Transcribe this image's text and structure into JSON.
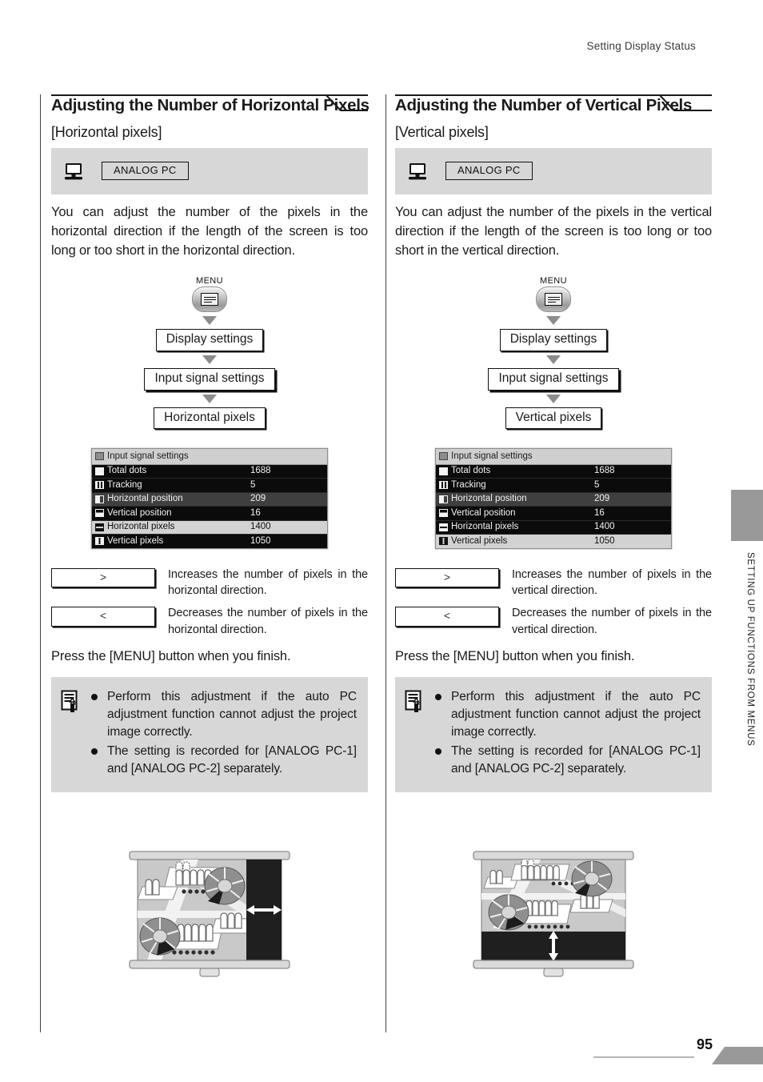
{
  "header": {
    "running_head": "Setting Display Status"
  },
  "footer": {
    "page_number": "95"
  },
  "side_tab": {
    "label": "SETTING UP FUNCTIONS FROM MENUS"
  },
  "columns": [
    {
      "title": "Adjusting the Number of Horizontal Pixels",
      "subtitle": "[Horizontal pixels]",
      "signal": {
        "icon": "analog-pc-monitor-icon",
        "chip": "ANALOG PC"
      },
      "description": "You can adjust the number of the pixels in the horizontal direction if the length of the screen is too long or too short in the horizontal direction.",
      "flow": {
        "menu_caption": "MENU",
        "steps": [
          "Display settings",
          "Input signal settings",
          "Horizontal pixels"
        ]
      },
      "osd": {
        "title": "Input signal settings",
        "rows": [
          {
            "icon": "fill-square-icon",
            "label": "Total dots",
            "value": "1688",
            "style": "dark"
          },
          {
            "icon": "bars-icon",
            "label": "Tracking",
            "value": "5",
            "style": "dark"
          },
          {
            "icon": "half-square-icon",
            "label": "Horizontal position",
            "value": "209",
            "style": "mid"
          },
          {
            "icon": "monitor-small-icon",
            "label": "Vertical position",
            "value": "16",
            "style": "dark"
          },
          {
            "icon": "hsplit-icon",
            "label": "Horizontal pixels",
            "value": "1400",
            "style": "selected"
          },
          {
            "icon": "vsplit-icon",
            "label": "Vertical pixels",
            "value": "1050",
            "style": "dark"
          }
        ]
      },
      "keys": [
        {
          "button": ">",
          "desc": "Increases the number of pixels in the horizontal direction."
        },
        {
          "button": "<",
          "desc": "Decreases the number of pixels in the horizontal direction."
        }
      ],
      "finish": "Press the [MENU] button when you finish.",
      "note": {
        "icon": "memo-pencil-icon",
        "items": [
          "Perform this adjustment if the auto PC adjustment function cannot adjust the project image correctly.",
          "The setting is recorded for [ANALOG PC-1] and [ANALOG PC-2] separately."
        ]
      },
      "illustration": {
        "name": "projection-screen-horizontal",
        "arrow": "horizontal-double-arrow",
        "band": "right"
      }
    },
    {
      "title": "Adjusting the Number of Vertical Pixels",
      "subtitle": "[Vertical pixels]",
      "signal": {
        "icon": "analog-pc-monitor-icon",
        "chip": "ANALOG PC"
      },
      "description": "You can adjust the number of the pixels in the vertical direction if the length of the screen is too long or too short in the vertical direction.",
      "flow": {
        "menu_caption": "MENU",
        "steps": [
          "Display settings",
          "Input signal settings",
          "Vertical pixels"
        ]
      },
      "osd": {
        "title": "Input signal settings",
        "rows": [
          {
            "icon": "fill-square-icon",
            "label": "Total dots",
            "value": "1688",
            "style": "dark"
          },
          {
            "icon": "bars-icon",
            "label": "Tracking",
            "value": "5",
            "style": "dark"
          },
          {
            "icon": "half-square-icon",
            "label": "Horizontal position",
            "value": "209",
            "style": "mid"
          },
          {
            "icon": "monitor-small-icon",
            "label": "Vertical position",
            "value": "16",
            "style": "dark"
          },
          {
            "icon": "hsplit-icon",
            "label": "Horizontal pixels",
            "value": "1400",
            "style": "dark"
          },
          {
            "icon": "vsplit-icon",
            "label": "Vertical pixels",
            "value": "1050",
            "style": "selected"
          }
        ]
      },
      "keys": [
        {
          "button": ">",
          "desc": "Increases the number of pixels in the vertical direction."
        },
        {
          "button": "<",
          "desc": "Decreases the number of pixels in the vertical direction."
        }
      ],
      "finish": "Press the [MENU] button when you finish.",
      "note": {
        "icon": "memo-pencil-icon",
        "items": [
          "Perform this adjustment if the auto PC adjustment function cannot adjust the project image correctly.",
          "The setting is recorded for [ANALOG PC-1] and [ANALOG PC-2] separately."
        ]
      },
      "illustration": {
        "name": "projection-screen-vertical",
        "arrow": "vertical-double-arrow",
        "band": "bottom"
      }
    }
  ]
}
